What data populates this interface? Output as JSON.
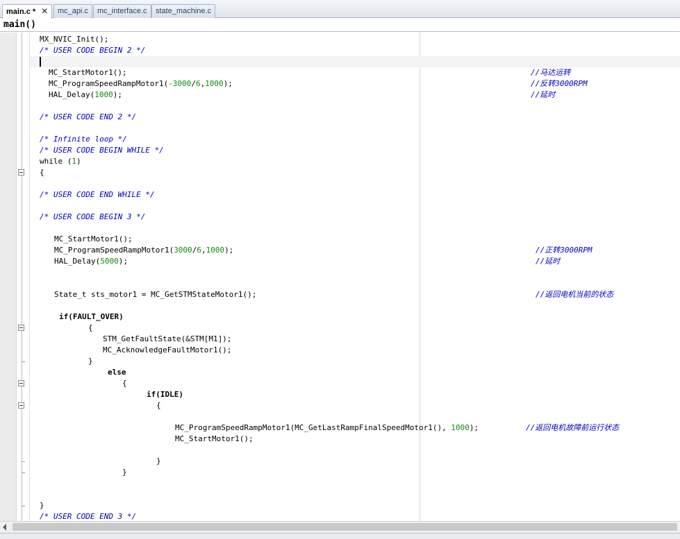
{
  "tabs": [
    {
      "label": "main.c *",
      "active": true,
      "close": "✕"
    },
    {
      "label": "mc_api.c",
      "active": false
    },
    {
      "label": "mc_interface.c",
      "active": false
    },
    {
      "label": "state_machine.c",
      "active": false
    }
  ],
  "function_bar": {
    "name": "main()"
  },
  "colors": {
    "comment": "#0000c8",
    "number": "#108a10",
    "text": "#000000"
  },
  "icons": {
    "fold": "minus-box-icon",
    "close": "close-icon"
  },
  "code": {
    "l1": "MX_NVIC_Init();",
    "l2": "/* USER CODE BEGIN 2 */",
    "l4a": "MC_StartMotor1();",
    "l4c": "//马达运转",
    "l5a": "MC_ProgramSpeedRampMotor1(",
    "l5n1": "-3000",
    "l5b": "/",
    "l5n2": "6",
    "l5c": ",",
    "l5n3": "1000",
    "l5d": ");",
    "l5cm": "//反转3000RPM",
    "l6a": "HAL_Delay(",
    "l6n": "1000",
    "l6b": ");",
    "l6cm": "//延时",
    "l8": "/* USER CODE END 2 */",
    "l10": "/* Infinite loop */",
    "l11": "/* USER CODE BEGIN WHILE */",
    "l12a": "while (",
    "l12n": "1",
    "l12b": ")",
    "l13": "{",
    "l15": "/* USER CODE END WHILE */",
    "l17": "/* USER CODE BEGIN 3 */",
    "l19": "MC_StartMotor1();",
    "l20a": "MC_ProgramSpeedRampMotor1(",
    "l20n1": "3000",
    "l20b": "/",
    "l20n2": "6",
    "l20c": ",",
    "l20n3": "1000",
    "l20d": ");",
    "l20cm": "//正转3000RPM",
    "l21a": "HAL_Delay(",
    "l21n": "5000",
    "l21b": ");",
    "l21cm": "//延时",
    "l24": "State_t sts_motor1 = MC_GetSTMStateMotor1();",
    "l24cm": "//返回电机当前的状态",
    "l26": "if(FAULT_OVER)",
    "l27": "{",
    "l28": "STM_GetFaultState(&STM[M1]);",
    "l29": "MC_AcknowledgeFaultMotor1();",
    "l30": "}",
    "l31": "else",
    "l32": "{",
    "l33": "if(IDLE)",
    "l34": "{",
    "l36a": "MC_ProgramSpeedRampMotor1(MC_GetLastRampFinalSpeedMotor1(), ",
    "l36n": "1000",
    "l36b": ");",
    "l36cm": "//返回电机故障前运行状态",
    "l37": "MC_StartMotor1();",
    "l39": "}",
    "l40": "}",
    "l44": "}",
    "l45": "/* USER CODE END 3 */"
  }
}
